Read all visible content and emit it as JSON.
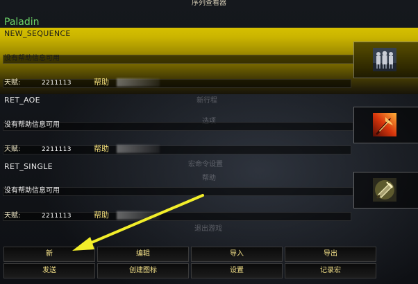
{
  "window": {
    "title": "序列查看器"
  },
  "class_name": "Paladin",
  "sequences": [
    {
      "name": "NEW_SEQUENCE",
      "help_text": "没有帮助信息可用",
      "talent_label": "天赋:",
      "talent_value": "2211113",
      "help_link": "帮助",
      "icon": "paladin-group-icon",
      "selected": true
    },
    {
      "name": "RET_AOE",
      "help_text": "没有帮助信息可用",
      "talent_label": "天赋:",
      "talent_value": "2211113",
      "help_link": "帮助",
      "icon": "flame-sword-icon",
      "selected": false
    },
    {
      "name": "RET_SINGLE",
      "help_text": "没有帮助信息可用",
      "talent_label": "天赋:",
      "talent_value": "2211113",
      "help_link": "帮助",
      "icon": "hammer-icon",
      "selected": false
    }
  ],
  "background_menu": [
    "新行程",
    "选项",
    "宏命令设置",
    "帮助",
    "退出游戏"
  ],
  "buttons": {
    "new": "新",
    "edit": "编辑",
    "import": "导入",
    "export": "导出",
    "send": "发送",
    "create_icon": "创建图标",
    "settings": "设置",
    "record_macro": "记录宏"
  },
  "colors": {
    "selected_highlight": "#d6c000",
    "class_name": "#6fd96a",
    "button_text": "#f6e38a",
    "arrow": "#f2ee2a"
  }
}
